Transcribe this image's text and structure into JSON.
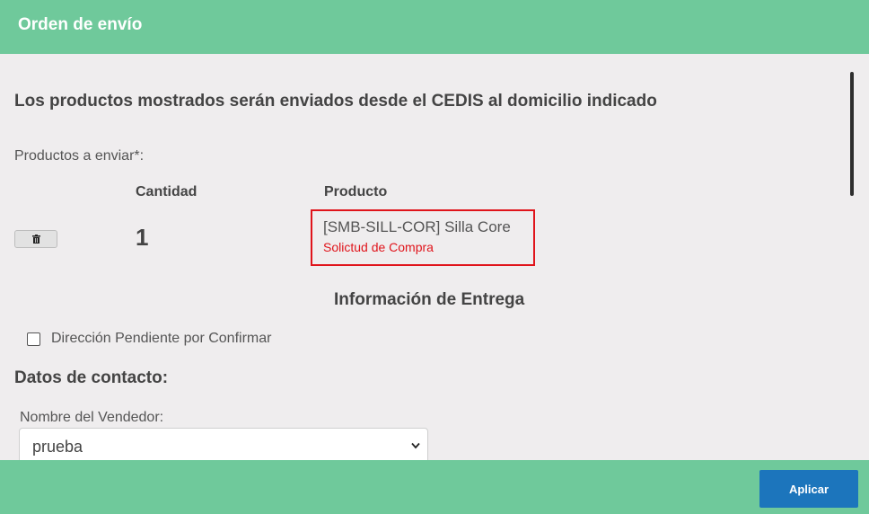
{
  "header": {
    "title": "Orden de envío"
  },
  "main": {
    "intro": "Los productos mostrados serán enviados desde el CEDIS al domicilio indicado",
    "products_label": "Productos a enviar*:",
    "columns": {
      "cantidad": "Cantidad",
      "producto": "Producto"
    },
    "rows": [
      {
        "delete_icon": "trash-icon",
        "quantity": "1",
        "product": "[SMB-SILL-COR] Silla Core",
        "note": "Solictud de Compra"
      }
    ],
    "delivery_title": "Información de Entrega",
    "pending_address": {
      "label": "Dirección Pendiente por Confirmar",
      "checked": false
    },
    "contact_title": "Datos de contacto:",
    "seller": {
      "label": "Nombre del Vendedor:",
      "value": "prueba"
    }
  },
  "footer": {
    "apply_label": "Aplicar"
  },
  "colors": {
    "bar": "#6fc99b",
    "button": "#1c75bc",
    "highlight": "#e0141b",
    "background": "#efedee"
  }
}
